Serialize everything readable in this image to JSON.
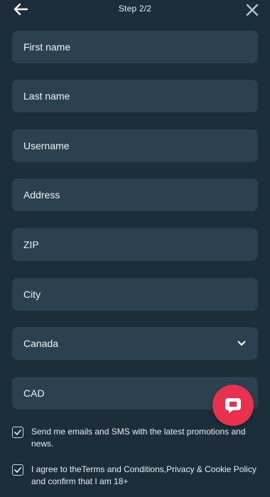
{
  "header": {
    "step": "Step 2/2",
    "back_icon": "arrow-left-icon",
    "close_icon": "close-icon"
  },
  "form": {
    "first_name": "First name",
    "last_name": "Last name",
    "username": "Username",
    "address": "Address",
    "zip": "ZIP",
    "city": "City",
    "country": "Canada",
    "currency": "CAD"
  },
  "consents": {
    "marketing": "Send me emails and SMS with the latest promotions and news.",
    "terms": "I agree to theTerms and Conditions,Privacy & Cookie Policy and confirm that I am 18+"
  },
  "chat": {
    "icon": "chat-bubble-icon"
  },
  "colors": {
    "background": "#1d2e3b",
    "field": "#2c4150",
    "accent": "#e8304f"
  }
}
